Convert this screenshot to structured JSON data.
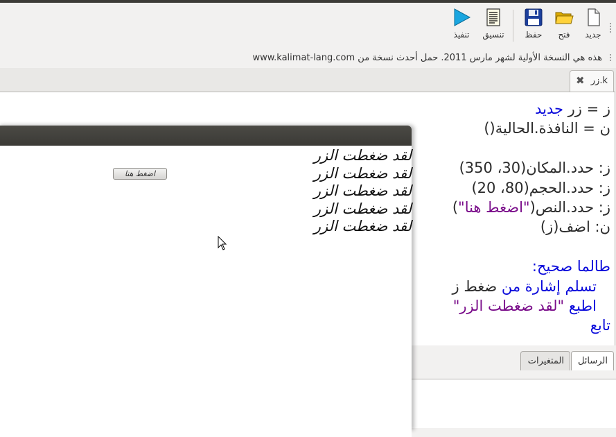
{
  "toolbar": {
    "buttons": [
      {
        "id": "new",
        "label": "جديد",
        "icon": "new-file-icon"
      },
      {
        "id": "open",
        "label": "فتح",
        "icon": "folder-open-icon"
      },
      {
        "id": "save",
        "label": "حفظ",
        "icon": "floppy-disk-icon"
      },
      {
        "id": "format",
        "label": "تنسيق",
        "icon": "document-format-icon"
      },
      {
        "id": "run",
        "label": "تنفيذ",
        "icon": "play-icon"
      }
    ]
  },
  "info": {
    "text": "هذه هي النسخة الأولية لشهر مارس 2011. حمل أحدث نسخة من www.kalimat-lang.com"
  },
  "editor_tab": {
    "label": "زر.k",
    "close_icon": "close-icon"
  },
  "code": {
    "lines": [
      [
        {
          "t": "ز = زر ",
          "c": "plain"
        },
        {
          "t": "جديد",
          "c": "kw"
        }
      ],
      [
        {
          "t": "ن = النافذة.الحالية()",
          "c": "plain"
        }
      ],
      [],
      [
        {
          "t": "ز: حدد.المكان(30، 350)",
          "c": "plain"
        }
      ],
      [
        {
          "t": "ز: حدد.الحجم(80، 20)",
          "c": "plain"
        }
      ],
      [
        {
          "t": "ز: حدد.النص(",
          "c": "plain"
        },
        {
          "t": "\"اضغط هنا\"",
          "c": "str"
        },
        {
          "t": ")",
          "c": "plain"
        }
      ],
      [
        {
          "t": "ن: اضف(ز)",
          "c": "plain"
        }
      ],
      [],
      [
        {
          "t": "طالما صحيح:",
          "c": "kw"
        }
      ],
      [
        {
          "t": "   ",
          "c": "plain"
        },
        {
          "t": "تسلم إشارة من ",
          "c": "kw"
        },
        {
          "t": "ضغط ز",
          "c": "plain"
        }
      ],
      [
        {
          "t": "   ",
          "c": "plain"
        },
        {
          "t": "اطبع ",
          "c": "kw"
        },
        {
          "t": "\"لقد ضغطت الزر\"",
          "c": "str"
        }
      ],
      [
        {
          "t": "تابع",
          "c": "kw"
        }
      ]
    ]
  },
  "bottom_tabs": {
    "messages": "الرسائل",
    "variables": "المتغيرات"
  },
  "run_window": {
    "button_label": "اضغط هنا",
    "output_lines": [
      "لقد ضغطت الزر",
      "لقد ضغطت الزر",
      "لقد ضغطت الزر",
      "لقد ضغطت الزر",
      "لقد ضغطت الزر"
    ]
  },
  "colors": {
    "keyword": "#0a0adb",
    "string": "#7a0d8a",
    "titlebar": "#3c3b37"
  }
}
